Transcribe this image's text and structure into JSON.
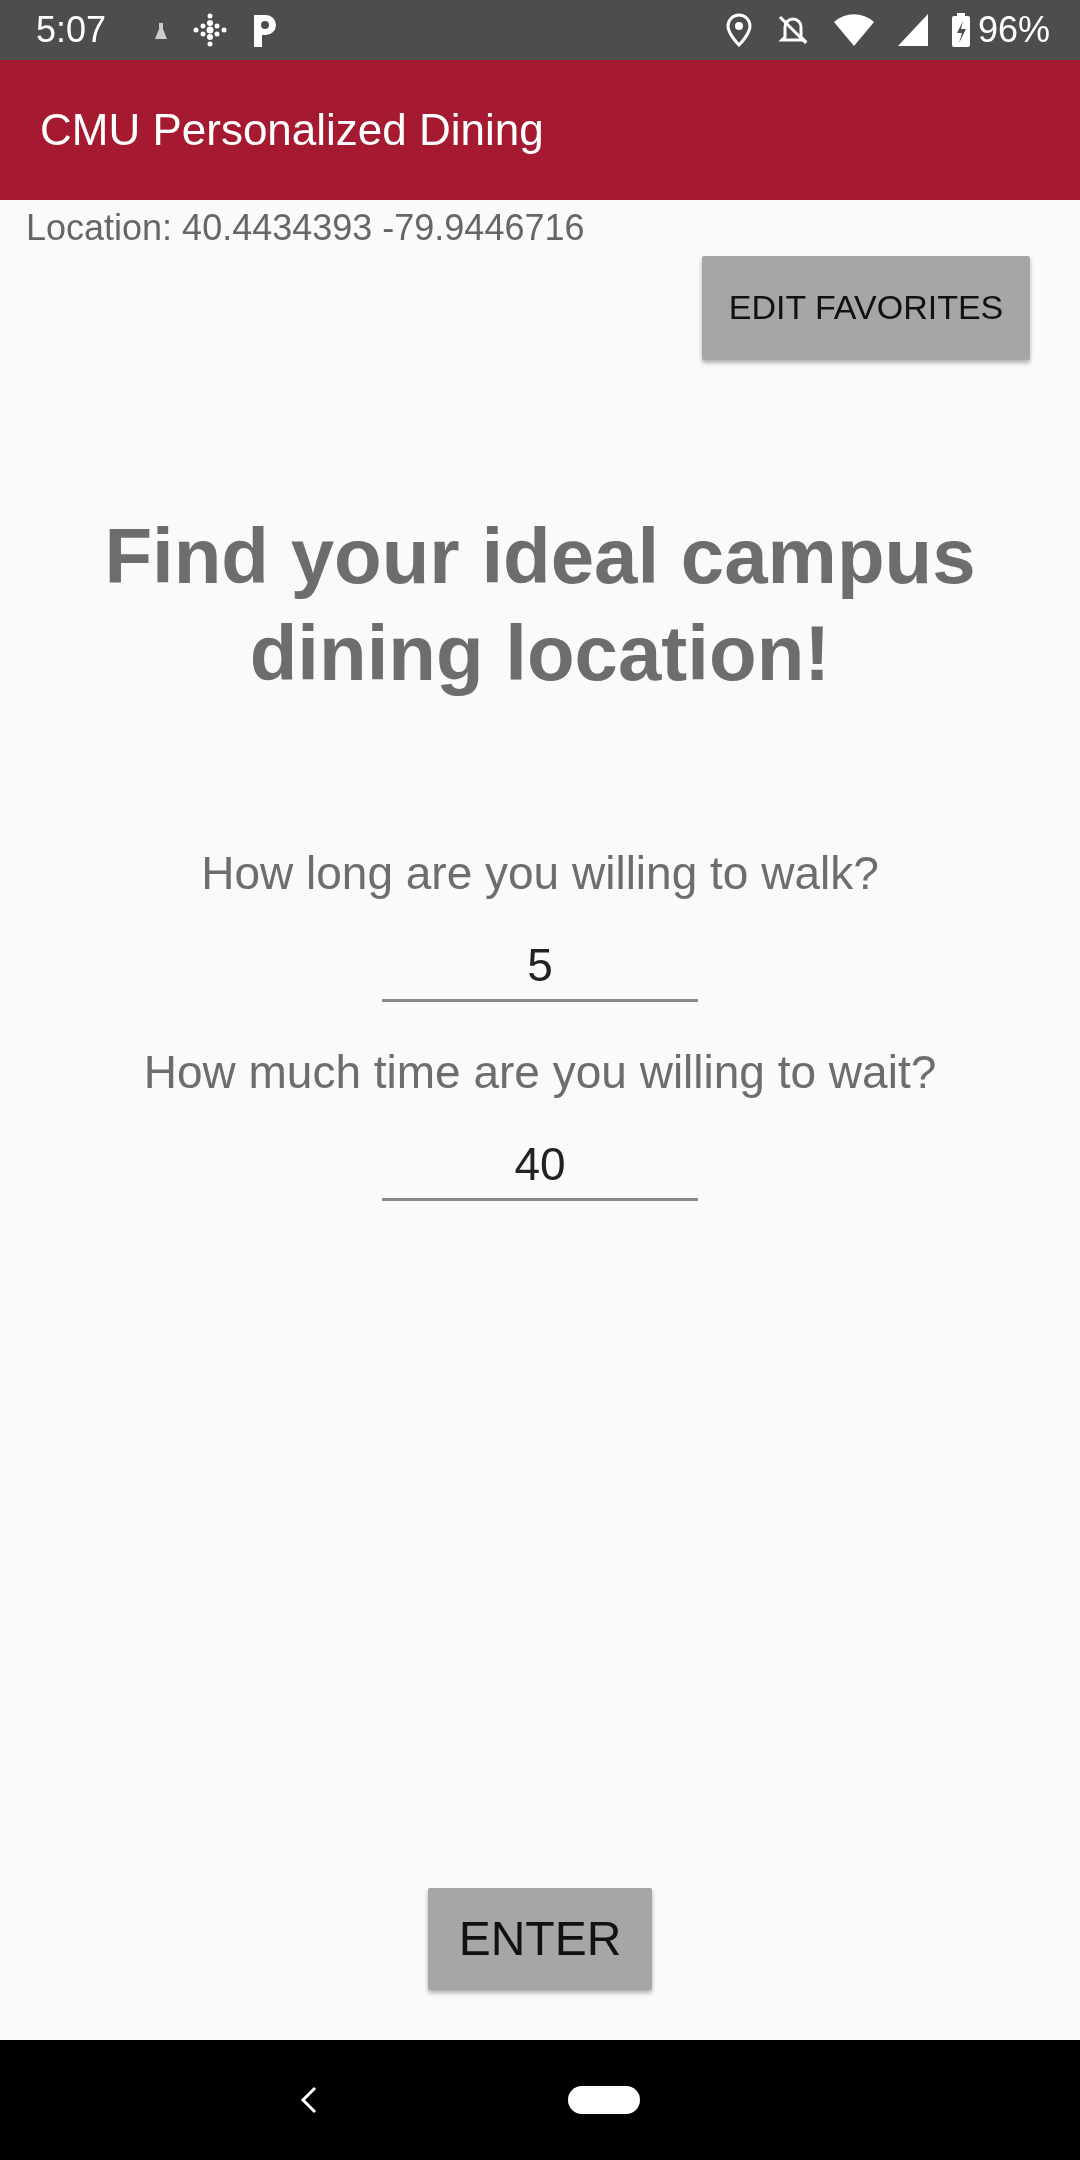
{
  "status_bar": {
    "time": "5:07",
    "battery": "96%"
  },
  "app_bar": {
    "title": "CMU Personalized Dining"
  },
  "location": "Location: 40.4434393 -79.9446716",
  "edit_favorites_button": "EDIT FAVORITES",
  "headline": "Find your ideal campus dining location!",
  "questions": [
    {
      "label": "How long are you willing to walk?",
      "value": "5"
    },
    {
      "label": "How much time are you willing to wait?",
      "value": "40"
    }
  ],
  "enter_button": "ENTER"
}
